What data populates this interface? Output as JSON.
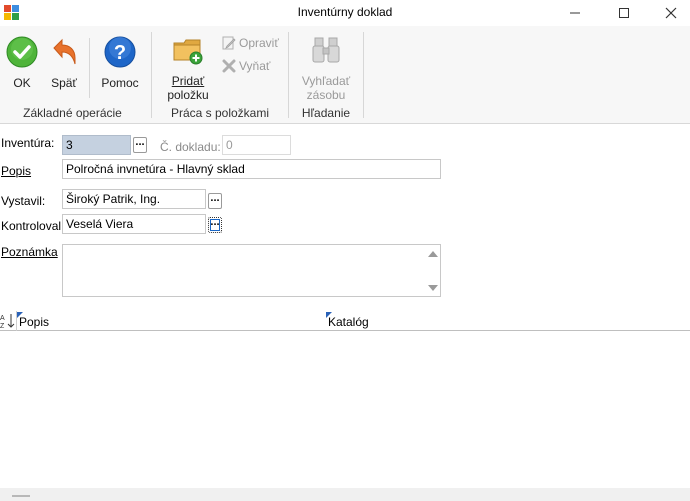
{
  "window": {
    "title": "Inventúrny doklad",
    "minimize": "—",
    "maximize": "☐",
    "close": "✕"
  },
  "ribbon": {
    "groups": [
      {
        "label": "Základné operácie",
        "buttons": [
          "OK",
          "Späť",
          "Pomoc"
        ]
      },
      {
        "label": "Práca s položkami",
        "buttons": [
          "Pridať položku",
          "Opraviť",
          "Vyňať"
        ]
      },
      {
        "label": "Hľadanie",
        "buttons": [
          "Vyhľadať zásobu"
        ]
      }
    ],
    "ok": "OK",
    "back": "Späť",
    "help": "Pomoc",
    "add_item_line1": "Pridať",
    "add_item_line2": "položku",
    "edit": "Opraviť",
    "remove": "Vyňať",
    "search_line1": "Vyhľadať",
    "search_line2": "zásobu",
    "group_basic": "Základné operácie",
    "group_items": "Práca s položkami",
    "group_search": "Hľadanie"
  },
  "form": {
    "inventura_label": "Inventúra:",
    "inventura_value": "3",
    "doc_no_label": "Č. dokladu:",
    "doc_no_value": "0",
    "popis_label": "Popis",
    "popis_value": "Polročná invnetúra - Hlavný sklad",
    "vystavil_label": "Vystavil:",
    "vystavil_value": "Široký Patrik, Ing.",
    "kontroloval_label": "Kontroloval:",
    "kontroloval_value": "Veselá Viera",
    "poznamka_label": "Poznámka",
    "poznamka_value": "",
    "ellipsis": "..."
  },
  "grid": {
    "sort_icon": "A/Z sort",
    "columns": [
      "Popis",
      "Katalóg"
    ],
    "col_popis": "Popis",
    "col_katalog": "Katalóg"
  },
  "colors": {
    "ok_green": "#3aa33a",
    "back_orange": "#e8722c",
    "help_blue": "#1e66c8",
    "selected_field": "#c5d1e0"
  }
}
